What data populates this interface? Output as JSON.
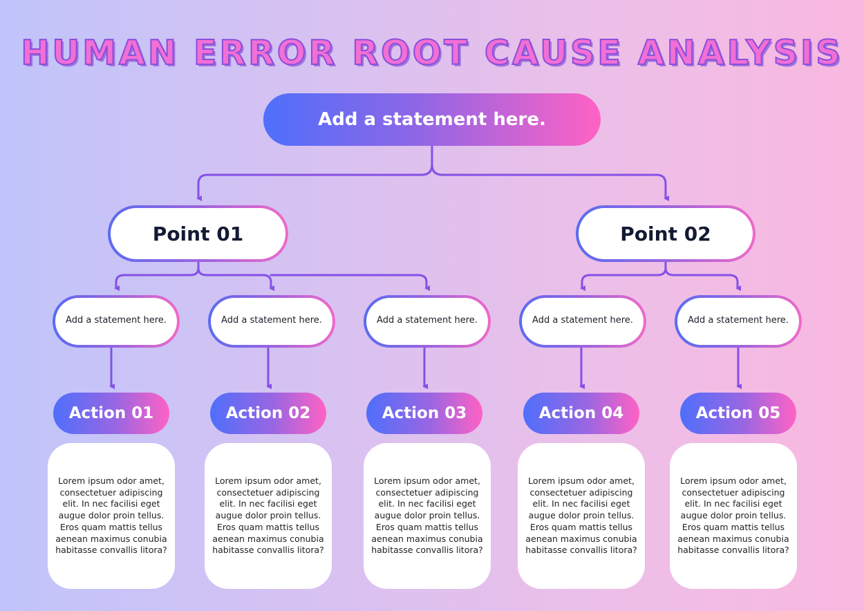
{
  "title": "HUMAN ERROR ROOT CAUSE ANALYSIS",
  "root": {
    "label": "Add a statement here."
  },
  "points": [
    {
      "label": "Point 01"
    },
    {
      "label": "Point 02"
    }
  ],
  "statements": [
    {
      "label": "Add a statement here.",
      "parent": "Point 01"
    },
    {
      "label": "Add a statement here.",
      "parent": "Point 01"
    },
    {
      "label": "Add a statement here.",
      "parent": "Point 01"
    },
    {
      "label": "Add a statement here.",
      "parent": "Point 02"
    },
    {
      "label": "Add a statement here.",
      "parent": "Point 02"
    }
  ],
  "actions": [
    {
      "label": "Action 01",
      "text": "Lorem ipsum odor amet, consectetuer adipiscing elit. In nec facilisi eget augue dolor proin tellus. Eros quam mattis tellus aenean maximus conubia habitasse convallis litora?"
    },
    {
      "label": "Action 02",
      "text": "Lorem ipsum odor amet, consectetuer adipiscing elit. In nec facilisi eget augue dolor proin tellus. Eros quam mattis tellus aenean maximus conubia habitasse convallis litora?"
    },
    {
      "label": "Action 03",
      "text": "Lorem ipsum odor amet, consectetuer adipiscing elit. In nec facilisi eget augue dolor proin tellus. Eros quam mattis tellus aenean maximus conubia habitasse convallis litora?"
    },
    {
      "label": "Action 04",
      "text": "Lorem ipsum odor amet, consectetuer adipiscing elit. In nec facilisi eget augue dolor proin tellus. Eros quam mattis tellus aenean maximus conubia habitasse convallis litora?"
    },
    {
      "label": "Action 05",
      "text": "Lorem ipsum odor amet, consectetuer adipiscing elit. In nec facilisi eget augue dolor proin tellus. Eros quam mattis tellus aenean maximus conubia habitasse convallis litora?"
    }
  ],
  "colors": {
    "gradient_start": "#4f6ffb",
    "gradient_end": "#ff62c4",
    "connector": "#8550e6",
    "title_fill": "#f26fd6",
    "title_outline": "#8a4fd9"
  }
}
